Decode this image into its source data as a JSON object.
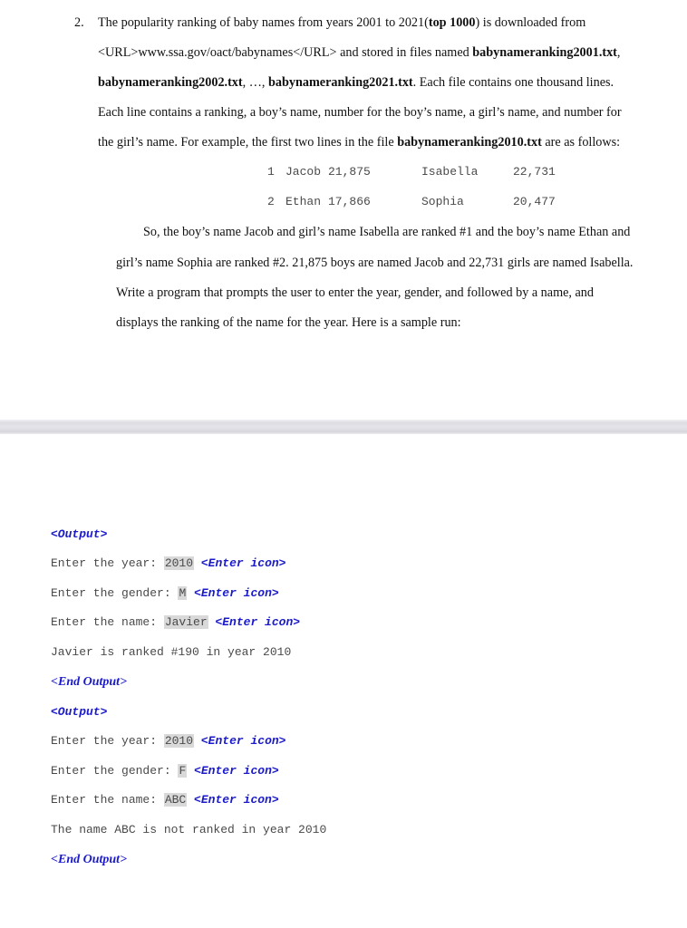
{
  "problem": {
    "number": "2.",
    "lines": [
      {
        "segments": [
          {
            "t": "The popularity ranking of baby names from years 2001 to 2021("
          },
          {
            "t": "top 1000",
            "b": true
          },
          {
            "t": ") is downloaded from"
          }
        ]
      },
      {
        "segments": [
          {
            "t": "<URL>www.ssa.gov/oact/babynames</URL> and stored in files named "
          },
          {
            "t": "babynameranking2001.txt",
            "b": true
          },
          {
            "t": ","
          }
        ]
      },
      {
        "segments": [
          {
            "t": "babynameranking2002.txt",
            "b": true
          },
          {
            "t": ", …, "
          },
          {
            "t": "babynameranking2021.txt",
            "b": true
          },
          {
            "t": ". Each file contains one thousand lines."
          }
        ]
      },
      {
        "segments": [
          {
            "t": "Each line contains a ranking, a boy’s name, number for the boy’s name, a girl’s name, and number for"
          }
        ]
      },
      {
        "segments": [
          {
            "t": "the girl’s name. For example, the first two lines in the file "
          },
          {
            "t": "babynameranking2010.txt",
            "b": true
          },
          {
            "t": " are as follows:"
          }
        ]
      }
    ],
    "example_table": [
      {
        "rank": "1",
        "boy_name": "Jacob",
        "boy_count": "21,875",
        "girl_name": "Isabella",
        "girl_count": "22,731"
      },
      {
        "rank": "2",
        "boy_name": "Ethan",
        "boy_count": "17,866",
        "girl_name": "Sophia",
        "girl_count": "20,477"
      }
    ],
    "paragraph2": [
      "So, the boy’s name Jacob and girl’s name Isabella are ranked #1 and the boy’s name Ethan and",
      "girl’s name Sophia are ranked #2. 21,875 boys are named Jacob and 22,731 girls are named Isabella.",
      "Write a program that prompts the user to enter the year, gender, and followed by a name, and",
      "displays the ranking of the name for the year. Here is a sample run:"
    ]
  },
  "sample_runs": [
    {
      "open_tag": "<Output>",
      "prompts": [
        {
          "label": "Enter the year: ",
          "input": "2010",
          "enter": "<Enter icon>"
        },
        {
          "label": "Enter the gender: ",
          "input": "M",
          "enter": "<Enter icon>"
        },
        {
          "label": "Enter the name: ",
          "input": "Javier",
          "enter": "<Enter icon>"
        }
      ],
      "result": "Javier is ranked #190 in year 2010",
      "close_tag": "<End Output>"
    },
    {
      "open_tag": "<Output>",
      "prompts": [
        {
          "label": "Enter the year: ",
          "input": "2010",
          "enter": "<Enter icon>"
        },
        {
          "label": "Enter the gender: ",
          "input": "F",
          "enter": "<Enter icon>"
        },
        {
          "label": "Enter the name: ",
          "input": "ABC",
          "enter": "<Enter icon>"
        }
      ],
      "result": "The name ABC is not ranked in year 2010",
      "close_tag": "<End Output>"
    }
  ],
  "colors": {
    "tag_blue": "#1a1acc",
    "highlight": "#d9d9d9",
    "code_gray": "#4a4a4a"
  }
}
